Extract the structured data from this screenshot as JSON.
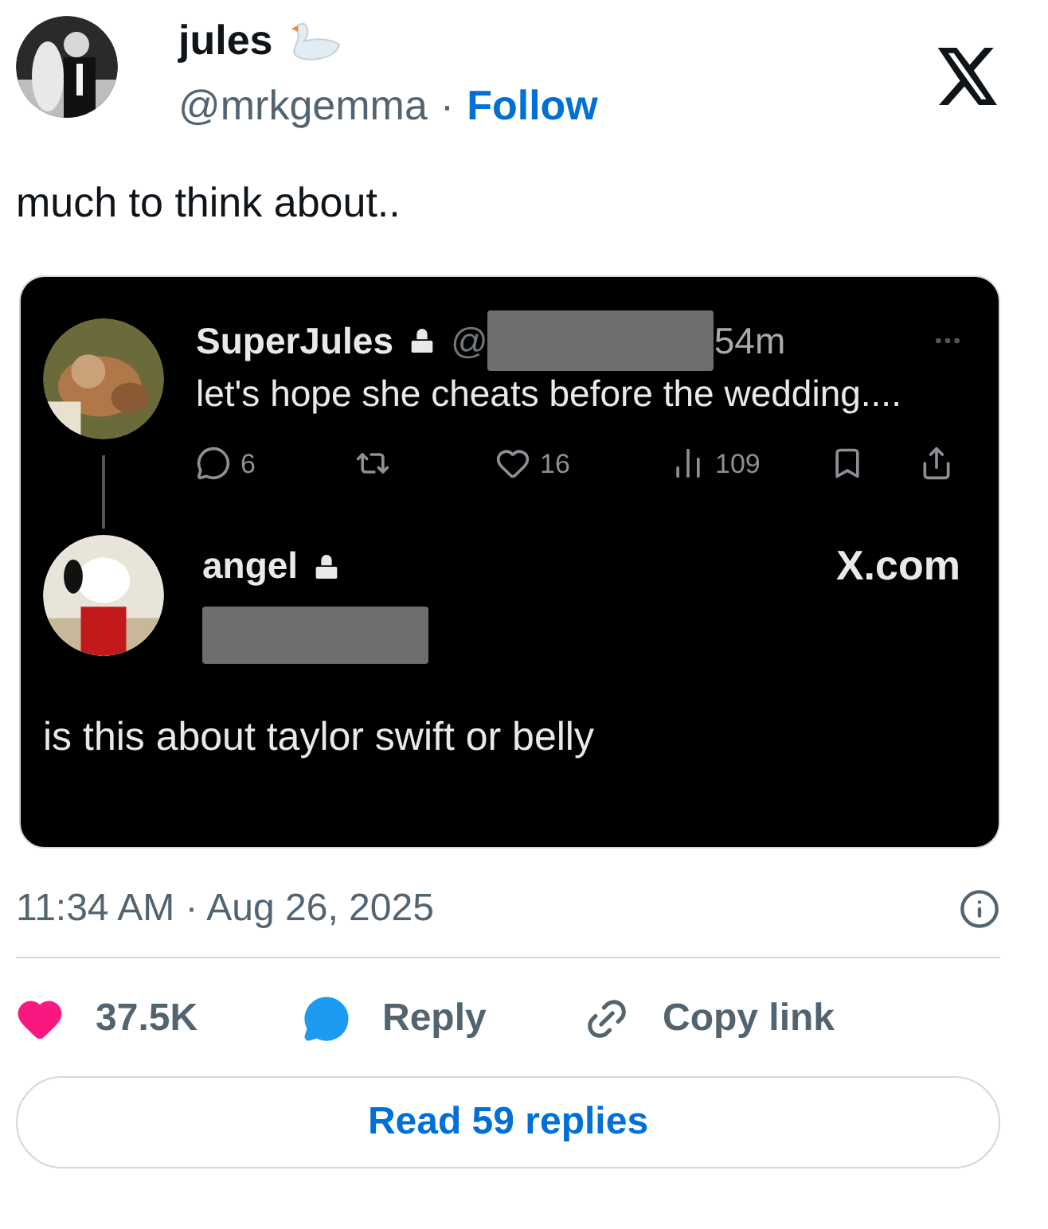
{
  "author": {
    "name": "jules",
    "handle": "@mrkgemma",
    "separator": "·",
    "follow": "Follow"
  },
  "text": "much to think about..",
  "embedded_screenshot": {
    "quoted": {
      "name": "SuperJules",
      "handle": "@",
      "time": "54m",
      "text": "let's hope she cheats before the wedding....",
      "stats": [
        {
          "kind": "reply",
          "count": "6"
        },
        {
          "kind": "retweet"
        },
        {
          "kind": "like",
          "count": "16"
        },
        {
          "kind": "views",
          "count": "109"
        },
        {
          "kind": "bookmark"
        },
        {
          "kind": "share"
        }
      ]
    },
    "reply": {
      "name": "angel",
      "text": "is this about taylor swift or belly"
    },
    "site": "X.com"
  },
  "timestamp": "11:34 AM · Aug 26, 2025",
  "actions": [
    {
      "kind": "like",
      "label": "37.5K"
    },
    {
      "kind": "reply",
      "label": "Reply"
    },
    {
      "kind": "copy",
      "label": "Copy link"
    }
  ],
  "read_replies": "Read 59 replies"
}
